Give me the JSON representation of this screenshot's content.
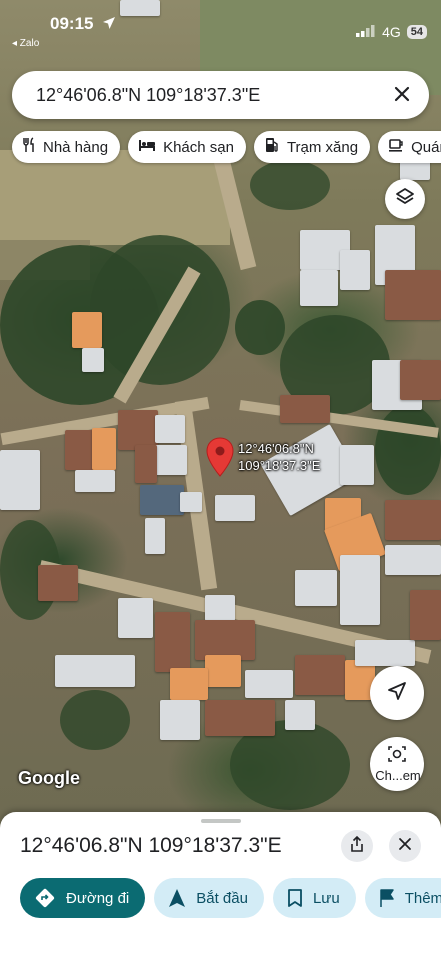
{
  "status_bar": {
    "time": "09:15",
    "back_app": "◂ Zalo",
    "network": "4G",
    "battery": "54"
  },
  "search": {
    "value": "12°46'06.8\"N 109°18'37.3\"E"
  },
  "chips": [
    {
      "icon": "restaurant-icon",
      "label": "Nhà hàng"
    },
    {
      "icon": "hotel-icon",
      "label": "Khách sạn"
    },
    {
      "icon": "gas-station-icon",
      "label": "Trạm xăng"
    },
    {
      "icon": "coffee-icon",
      "label": "Quán"
    }
  ],
  "pin": {
    "line1": "12°46'06.8\"N",
    "line2": "109°18'37.3\"E"
  },
  "map": {
    "attribution": "Google",
    "lens_label": "Ch...em"
  },
  "sheet": {
    "title": "12°46'06.8\"N 109°18'37.3\"E",
    "actions": [
      {
        "icon": "directions-icon",
        "label": "Đường đi"
      },
      {
        "icon": "navigation-icon",
        "label": "Bắt đầu"
      },
      {
        "icon": "bookmark-icon",
        "label": "Lưu"
      },
      {
        "icon": "flag-icon",
        "label": "Thêm"
      }
    ]
  },
  "colors": {
    "primary": "#0b6b72",
    "secondary": "#d3ecf6",
    "pin": "#e53935"
  }
}
